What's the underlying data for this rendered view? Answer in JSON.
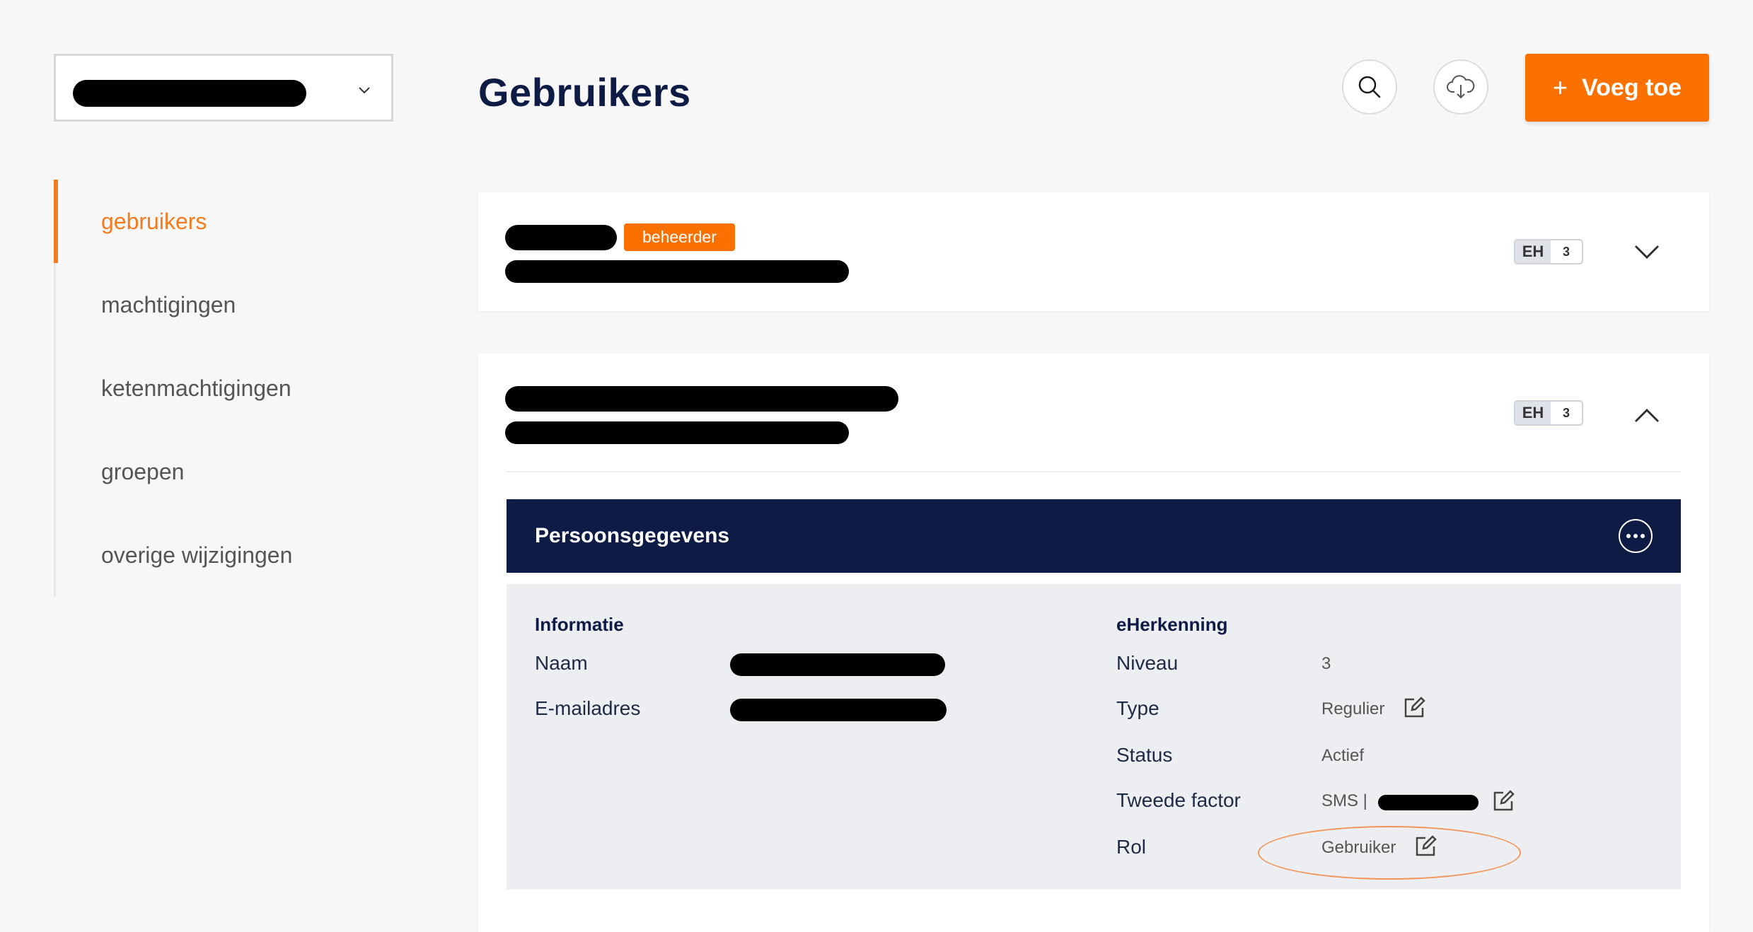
{
  "org_selector": {
    "value": "[redacted]"
  },
  "sidebar": {
    "items": [
      {
        "label": "gebruikers",
        "active": true
      },
      {
        "label": "machtigingen",
        "active": false
      },
      {
        "label": "ketenmachtigingen",
        "active": false
      },
      {
        "label": "groepen",
        "active": false
      },
      {
        "label": "overige wijzigingen",
        "active": false
      }
    ]
  },
  "header": {
    "title": "Gebruikers",
    "search_icon": "search-icon",
    "download_icon": "cloud-download-icon",
    "add_button": {
      "icon": "+",
      "label": "Voeg toe"
    }
  },
  "users": [
    {
      "name": "[redacted]",
      "email": "[redacted]",
      "role_badge": "beheerder",
      "eh_label": "EH",
      "eh_level": "3",
      "expanded": false
    },
    {
      "name": "[redacted]",
      "email": "[redacted]",
      "eh_label": "EH",
      "eh_level": "3",
      "expanded": true,
      "section_title": "Persoonsgegevens",
      "informatie": {
        "title": "Informatie",
        "fields": [
          {
            "label": "Naam",
            "value": "[redacted]"
          },
          {
            "label": "E-mailadres",
            "value": "[redacted]"
          }
        ]
      },
      "eherkenning": {
        "title": "eHerkenning",
        "fields": [
          {
            "label": "Niveau",
            "value": "3",
            "editable": false
          },
          {
            "label": "Type",
            "value": "Regulier",
            "editable": true
          },
          {
            "label": "Status",
            "value": "Actief",
            "editable": false
          },
          {
            "label": "Tweede factor",
            "value": "SMS | ",
            "value_redacted": true,
            "editable": true
          },
          {
            "label": "Rol",
            "value": "Gebruiker",
            "editable": true,
            "highlighted": true
          }
        ]
      }
    }
  ],
  "colors": {
    "accent": "#fb7100",
    "navy": "#0e1b44",
    "background": "#f7f7f8",
    "panel": "#eceef2"
  }
}
